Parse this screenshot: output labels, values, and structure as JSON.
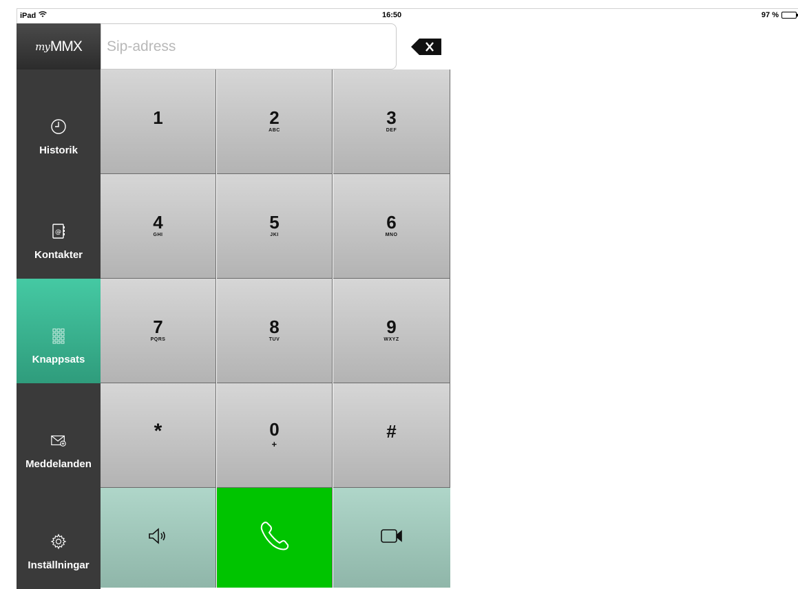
{
  "status": {
    "device": "iPad",
    "time": "16:50",
    "battery": "97 %",
    "battery_level": 0.97
  },
  "logo": {
    "prefix": "my",
    "name": "MMX"
  },
  "sidebar": {
    "items": [
      {
        "label": "Historik",
        "icon": "clock-icon"
      },
      {
        "label": "Kontakter",
        "icon": "address-book-icon"
      },
      {
        "label": "Knappsats",
        "icon": "keypad-icon",
        "active": true
      },
      {
        "label": "Meddelanden",
        "icon": "envelope-icon"
      },
      {
        "label": "Inställningar",
        "icon": "gear-icon"
      }
    ]
  },
  "sip": {
    "placeholder": "Sip-adress",
    "value": ""
  },
  "keys": [
    {
      "digit": "1",
      "letters": ""
    },
    {
      "digit": "2",
      "letters": "ABC"
    },
    {
      "digit": "3",
      "letters": "DEF"
    },
    {
      "digit": "4",
      "letters": "GHI"
    },
    {
      "digit": "5",
      "letters": "JKI"
    },
    {
      "digit": "6",
      "letters": "MNO"
    },
    {
      "digit": "7",
      "letters": "PQRS"
    },
    {
      "digit": "8",
      "letters": "TUV"
    },
    {
      "digit": "9",
      "letters": "WXYZ"
    },
    {
      "digit": "*",
      "letters": ""
    },
    {
      "digit": "0",
      "letters": "+"
    },
    {
      "digit": "#",
      "letters": ""
    }
  ],
  "actions": {
    "speaker": "speaker-icon",
    "call": "phone-icon",
    "video": "video-camera-icon"
  },
  "colors": {
    "active_nav": "#45c9a3",
    "call_green": "#00c400",
    "sidebar_bg": "#3a3a3a"
  }
}
